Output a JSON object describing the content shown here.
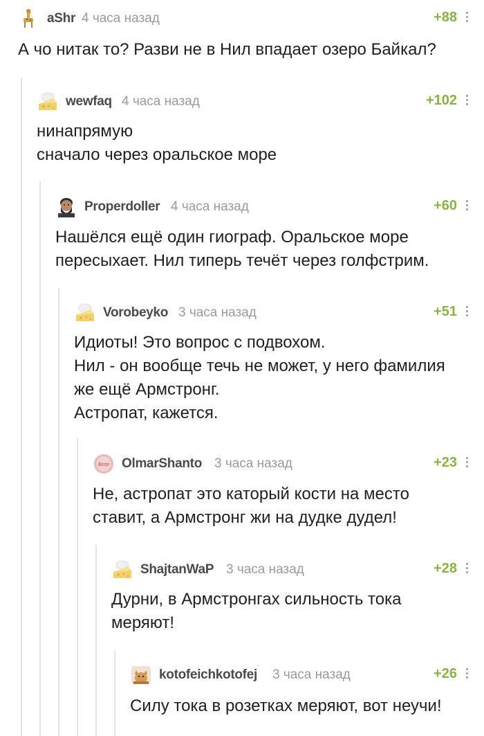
{
  "comments": [
    {
      "author": "aShr",
      "time": "4 часа назад",
      "rating": "+88",
      "avatar": "giraffe-icon",
      "lines": [
        "А чо нитак то? Разви не в Нил впадает озеро Байкал?"
      ]
    },
    {
      "author": "wewfaq",
      "time": "4 часа назад",
      "rating": "+102",
      "avatar": "cheese-icon",
      "lines": [
        "нинапрямую",
        "сначало через оральское море"
      ]
    },
    {
      "author": "Properdoller",
      "time": "4 часа назад",
      "rating": "+60",
      "avatar": "bearded-man-icon",
      "lines": [
        "Нашёлся ещё один гиограф. Оральское море",
        "пересыхает. Нил типерь течёт через голфстрим."
      ]
    },
    {
      "author": "Vorobeyko",
      "time": "3 часа назад",
      "rating": "+51",
      "avatar": "cheese-icon",
      "lines": [
        "Идиоты! Это вопрос с подвохом.",
        "Нил - он вообще течь не может, у него фамилия",
        "же ещё Армстронг.",
        "Астропат, кажется."
      ]
    },
    {
      "author": "OlmarShanto",
      "time": "3 часа назад",
      "rating": "+23",
      "avatar": "error-icon",
      "avatar_text": "Error",
      "lines": [
        "Не, астропат это каторый кости на место",
        "ставит, а Армстронг жи на дудке дудел!"
      ]
    },
    {
      "author": "ShajtanWaP",
      "time": "3 часа назад",
      "rating": "+28",
      "avatar": "cheese-icon",
      "lines": [
        "Дурни, в Армстронгах сильность тока",
        "меряют!"
      ]
    },
    {
      "author": "kotofeichkotofej",
      "time": "3 часа назад",
      "rating": "+26",
      "avatar": "cat-icon",
      "lines": [
        "Силу тока в розетках меряют, вот неучи!"
      ]
    }
  ]
}
